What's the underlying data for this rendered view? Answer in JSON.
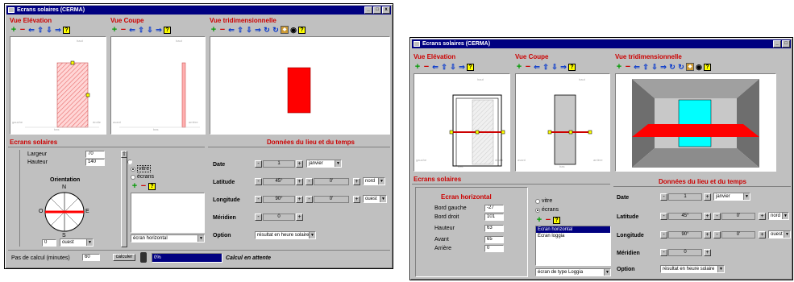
{
  "window1": {
    "title": "Ecrans solaires (CERMA)",
    "btn_min": "_",
    "btn_max": "□",
    "btn_close": "x",
    "panel_elevation": "Vue Elévation",
    "panel_coupe": "Vue Coupe",
    "panel_3d": "Vue tridimensionnelle",
    "elev_labels": {
      "top": "haut",
      "left": "gauche",
      "right": "droite",
      "bottom": "bas"
    },
    "coupe_labels": {
      "top": "haut",
      "left": "avant",
      "right": "arrière",
      "bottom": "bas"
    },
    "section_ecrans": "Ecrans solaires",
    "largeur_label": "Largeur",
    "largeur_value": "70",
    "hauteur_label": "Hauteur",
    "hauteur_value": "140",
    "orientation_label": "Orientation",
    "compass": {
      "n": "N",
      "s": "S",
      "e": "E",
      "o": "O"
    },
    "orientation_value": "0",
    "orientation_dir": "ouest",
    "radio_vitre": "vitre",
    "radio_ecrans": "écrans",
    "ecran_select": "écran horizontal",
    "section_donnees": "Données du lieu et du temps",
    "date_label": "Date",
    "date_day": "1",
    "date_month": "janvier",
    "latitude_label": "Latitude",
    "latitude_deg": "45°",
    "latitude_min": "0'",
    "latitude_dir": "nord",
    "longitude_label": "Longitude",
    "longitude_deg": "90°",
    "longitude_min": "0'",
    "longitude_dir": "ouest",
    "meridien_label": "Méridien",
    "meridien_value": "0",
    "option_label": "Option",
    "option_value": "résultat en heure solaire",
    "pas_label": "Pas de calcul (minutes)",
    "pas_value": "60",
    "calculer_label": "calculer",
    "progress_text": "0%",
    "progress_fraction": 0,
    "status_text": "Calcul en attente"
  },
  "window2": {
    "title": "Ecrans solaires (CERMA)",
    "btn_min": "_",
    "btn_max": "□",
    "panel_elevation": "Vue Elévation",
    "panel_coupe": "Vue Coupe",
    "panel_3d": "Vue tridimensionnelle",
    "elev_labels": {
      "top": "haut",
      "left": "gauche",
      "right": "droite",
      "bottom": "bas"
    },
    "coupe_labels": {
      "top": "haut",
      "left": "avant",
      "right": "arrière",
      "bottom": "bas"
    },
    "section_ecrans": "Ecrans solaires",
    "ecran_title": "Ecran horizontal",
    "fields": [
      {
        "label": "Bord gauche",
        "value": "-27"
      },
      {
        "label": "Bord droit",
        "value": "101"
      },
      {
        "label": "Hauteur",
        "value": "63"
      },
      {
        "label": "Avant",
        "value": "65"
      },
      {
        "label": "Arrière",
        "value": "0"
      }
    ],
    "radio_vitre": "vitre",
    "radio_ecrans": "écrans",
    "list_items": [
      "Ecran horizontal",
      "Ecran loggia"
    ],
    "list_selected": 0,
    "ecran_select": "écran de type Loggia",
    "section_donnees": "Données du lieu et du temps",
    "date_label": "Date",
    "date_day": "1",
    "date_month": "janvier",
    "latitude_label": "Latitude",
    "latitude_deg": "45°",
    "latitude_min": "0'",
    "latitude_dir": "nord",
    "longitude_label": "Longitude",
    "longitude_deg": "90°",
    "longitude_min": "0'",
    "longitude_dir": "ouest",
    "meridien_label": "Méridien",
    "meridien_value": "0",
    "option_label": "Option",
    "option_value": "résultat en heure solaire"
  },
  "icons": {
    "plus": "+",
    "minus": "−",
    "left": "⇐",
    "up": "⇧",
    "down": "⇩",
    "right": "⇒",
    "help": "?",
    "rotate": "↻",
    "perspective": "◆",
    "view": "◉",
    "spin_minus": "-",
    "spin_plus": "+",
    "dropdown": "▼"
  },
  "colors": {
    "title_bar": "#000080",
    "panel_title": "#cc0000",
    "screen_red": "#ff0000",
    "glass_cyan": "#00ffff"
  }
}
